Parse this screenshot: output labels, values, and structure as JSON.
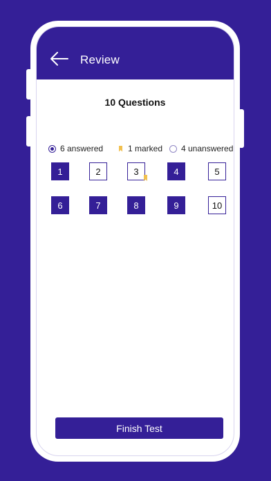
{
  "header": {
    "title": "Review",
    "back_icon": "arrow-left-icon"
  },
  "summary": {
    "title": "10 Questions"
  },
  "legend": {
    "answered": "6 answered",
    "marked": "1 marked",
    "unanswered": "4 unanswered"
  },
  "questions": [
    {
      "number": "1",
      "status": "answered",
      "marked": false
    },
    {
      "number": "2",
      "status": "unanswered",
      "marked": false
    },
    {
      "number": "3",
      "status": "unanswered",
      "marked": true
    },
    {
      "number": "4",
      "status": "answered",
      "marked": false
    },
    {
      "number": "5",
      "status": "unanswered",
      "marked": false
    },
    {
      "number": "6",
      "status": "answered",
      "marked": false
    },
    {
      "number": "7",
      "status": "answered",
      "marked": false
    },
    {
      "number": "8",
      "status": "answered",
      "marked": false
    },
    {
      "number": "9",
      "status": "answered",
      "marked": false
    },
    {
      "number": "10",
      "status": "unanswered",
      "marked": false
    }
  ],
  "footer": {
    "finish_label": "Finish Test"
  },
  "colors": {
    "primary": "#341f97",
    "marked": "#f1c04f",
    "background": "#ffffff"
  }
}
